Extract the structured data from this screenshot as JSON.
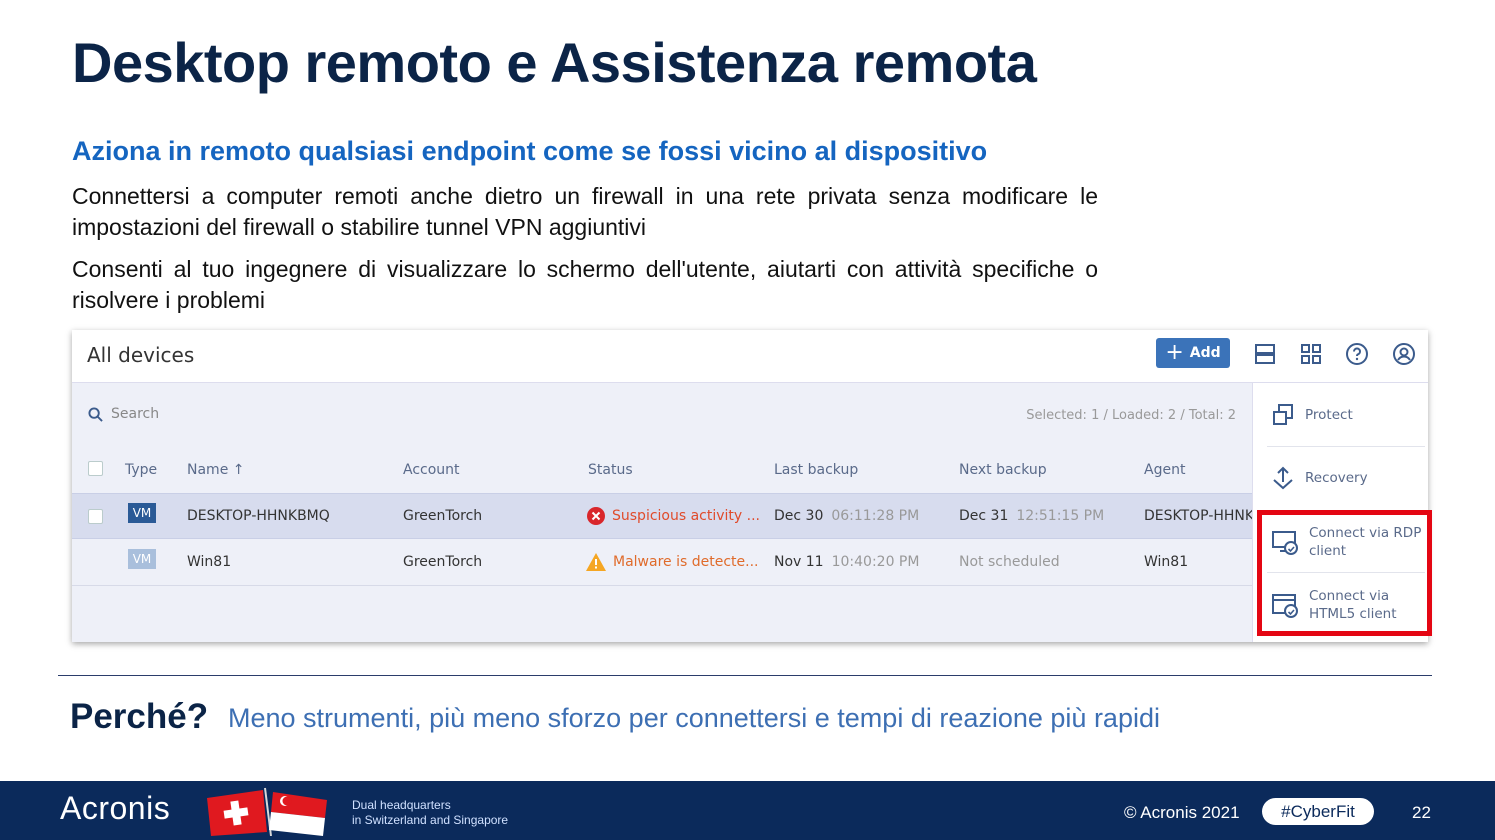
{
  "slide": {
    "title": "Desktop remoto e Assistenza remota",
    "subtitle": "Aziona in remoto qualsiasi endpoint come se fossi vicino al dispositivo",
    "paragraph1": "Connettersi a computer remoti anche dietro un firewall in una rete privata senza modificare le impostazioni del firewall o stabilire tunnel VPN aggiuntivi",
    "paragraph2": "Consenti al tuo ingegnere di visualizzare lo schermo dell'utente, aiutarti con attività specifiche o risolvere i problemi"
  },
  "console": {
    "title": "All devices",
    "add_label": "Add",
    "search_placeholder": "Search",
    "selection_status": "Selected: 1 / Loaded: 2 / Total: 2",
    "columns": {
      "type": "Type",
      "name": "Name",
      "name_sort": "↑",
      "account": "Account",
      "status": "Status",
      "last_backup": "Last backup",
      "next_backup": "Next backup",
      "agent": "Agent"
    },
    "rows": [
      {
        "type": "VM",
        "name": "DESKTOP-HHNKBMQ",
        "account": "GreenTorch",
        "status": "Suspicious activity ...",
        "status_color": "#e04b2b",
        "last_backup_date": "Dec 30",
        "last_backup_time": "06:11:28 PM",
        "next_backup_date": "Dec 31",
        "next_backup_time": "12:51:15 PM",
        "agent": "DESKTOP-HHNKB"
      },
      {
        "type": "VM",
        "name": "Win81",
        "account": "GreenTorch",
        "status": "Malware is detecte...",
        "status_color": "#e06b2b",
        "last_backup_date": "Nov 11",
        "last_backup_time": "10:40:20 PM",
        "next_backup_date": "Not scheduled",
        "next_backup_time": "",
        "agent": "Win81"
      }
    ],
    "actions": {
      "protect": "Protect",
      "recovery": "Recovery",
      "rdp_line1": "Connect via RDP",
      "rdp_line2": "client",
      "html5_line1": "Connect via",
      "html5_line2": "HTML5 client"
    },
    "icons": [
      "list-view-icon",
      "grid-view-icon",
      "help-icon",
      "account-icon",
      "search-icon",
      "protect-icon",
      "recovery-icon",
      "rdp-client-icon",
      "html5-client-icon"
    ]
  },
  "why": {
    "label": "Perché?",
    "text": "Meno strumenti, più meno sforzo per connettersi e tempi di reazione più rapidi"
  },
  "footer": {
    "logo": "Acronis",
    "hq_line1": "Dual headquarters",
    "hq_line2": "in Switzerland and Singapore",
    "copyright": "© Acronis 2021",
    "hashtag": "#CyberFit",
    "page_number": "22"
  },
  "colors": {
    "title": "#0b2447",
    "subtitle": "#1565c0",
    "highlight": "#e40613",
    "footer_bg": "#0b2a5b",
    "add_button": "#3b73b9"
  }
}
